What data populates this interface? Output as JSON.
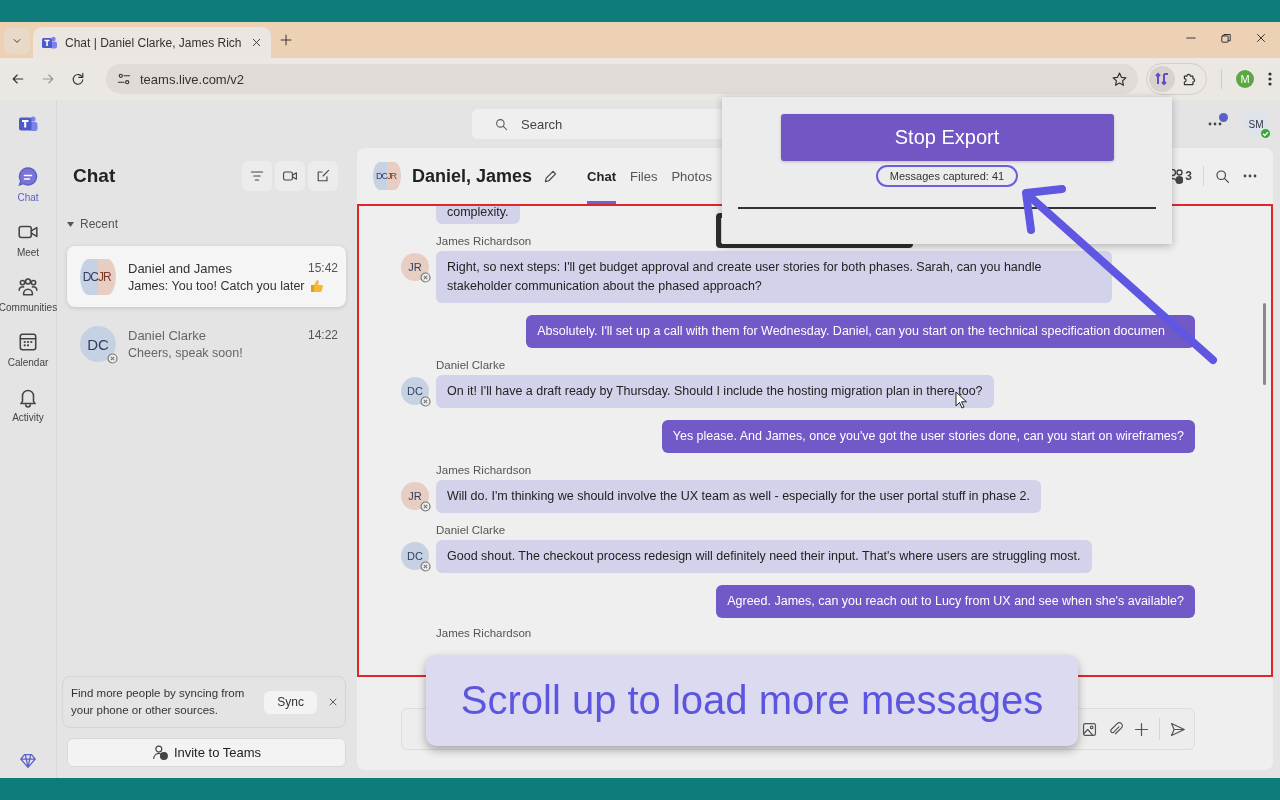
{
  "browser": {
    "tab_title": "Chat | Daniel Clarke, James Rich",
    "url": "teams.live.com/v2",
    "profile_initial": "M"
  },
  "rail": [
    {
      "label": "Chat",
      "selected": true
    },
    {
      "label": "Meet",
      "selected": false
    },
    {
      "label": "Communities",
      "selected": false
    },
    {
      "label": "Calendar",
      "selected": false
    },
    {
      "label": "Activity",
      "selected": false
    }
  ],
  "search": {
    "placeholder": "Search"
  },
  "user": {
    "initials": "SM",
    "online": true
  },
  "chat_list": {
    "title": "Chat",
    "section": "Recent",
    "items": [
      {
        "avatar": {
          "kind": "group",
          "parts": [
            {
              "initials": "DC",
              "color": "#c6d2e3"
            },
            {
              "initials": "JR",
              "color": "#e8cdc2"
            }
          ]
        },
        "name": "Daniel and James",
        "preview": "James: You too! Catch you later",
        "time": "15:42",
        "selected": true
      },
      {
        "avatar": {
          "kind": "person",
          "initials": "DC",
          "color": "#c6d2e3",
          "online": false
        },
        "name": "Daniel Clarke",
        "preview": "Cheers, speak soon!",
        "time": "14:22",
        "selected": false
      }
    ]
  },
  "sync_card": {
    "text": "Find more people by syncing from your phone or other sources.",
    "button": "Sync"
  },
  "invite_button": "Invite to Teams",
  "conversation": {
    "title": "Daniel, James",
    "avatar": {
      "kind": "group",
      "parts": [
        {
          "initials": "DC",
          "color": "#c6d2e3"
        },
        {
          "initials": "JR",
          "color": "#e8cdc2"
        }
      ]
    },
    "tabs": [
      {
        "label": "Chat",
        "selected": true
      },
      {
        "label": "Files",
        "selected": false
      },
      {
        "label": "Photos",
        "selected": false
      }
    ],
    "participants": "3",
    "messages": [
      {
        "kind": "continuation",
        "text": "complexity."
      },
      {
        "kind": "incoming",
        "sender": "James Richardson",
        "avatar": {
          "initials": "JR",
          "color": "#e8cdc2",
          "online": false
        },
        "text": "Right, so next steps: I'll get budget approval and create user stories for both phases. Sarah, can you handle stakeholder communication about the phased approach?"
      },
      {
        "kind": "outgoing",
        "text": "Absolutely. I'll set up a call with them for Wednesday. Daniel, can you start on the technical specification documen"
      },
      {
        "kind": "incoming",
        "sender": "Daniel Clarke",
        "avatar": {
          "initials": "DC",
          "color": "#c6d2e3",
          "online": false
        },
        "text": "On it! I'll have a draft ready by Thursday. Should I include the hosting migration plan in there too?"
      },
      {
        "kind": "outgoing",
        "text": "Yes please. And James, once you've got the user stories done, can you start on wireframes?"
      },
      {
        "kind": "incoming",
        "sender": "James Richardson",
        "avatar": {
          "initials": "JR",
          "color": "#e8cdc2",
          "online": false
        },
        "text": "Will do. I'm thinking we should involve the UX team as well - especially for the user portal stuff in phase 2."
      },
      {
        "kind": "incoming",
        "sender": "Daniel Clarke",
        "avatar": {
          "initials": "DC",
          "color": "#c6d2e3",
          "online": false
        },
        "text": "Good shout. The checkout process redesign will definitely need their input. That's where users are struggling most."
      },
      {
        "kind": "outgoing",
        "text": "Agreed. James, can you reach out to Lucy from UX and see when she's available?"
      },
      {
        "kind": "sender_only",
        "sender": "James Richardson"
      }
    ]
  },
  "extension_popup": {
    "button": "Stop Export",
    "status": "Messages captured: 41"
  },
  "hint": "Scroll up to load more messages"
}
